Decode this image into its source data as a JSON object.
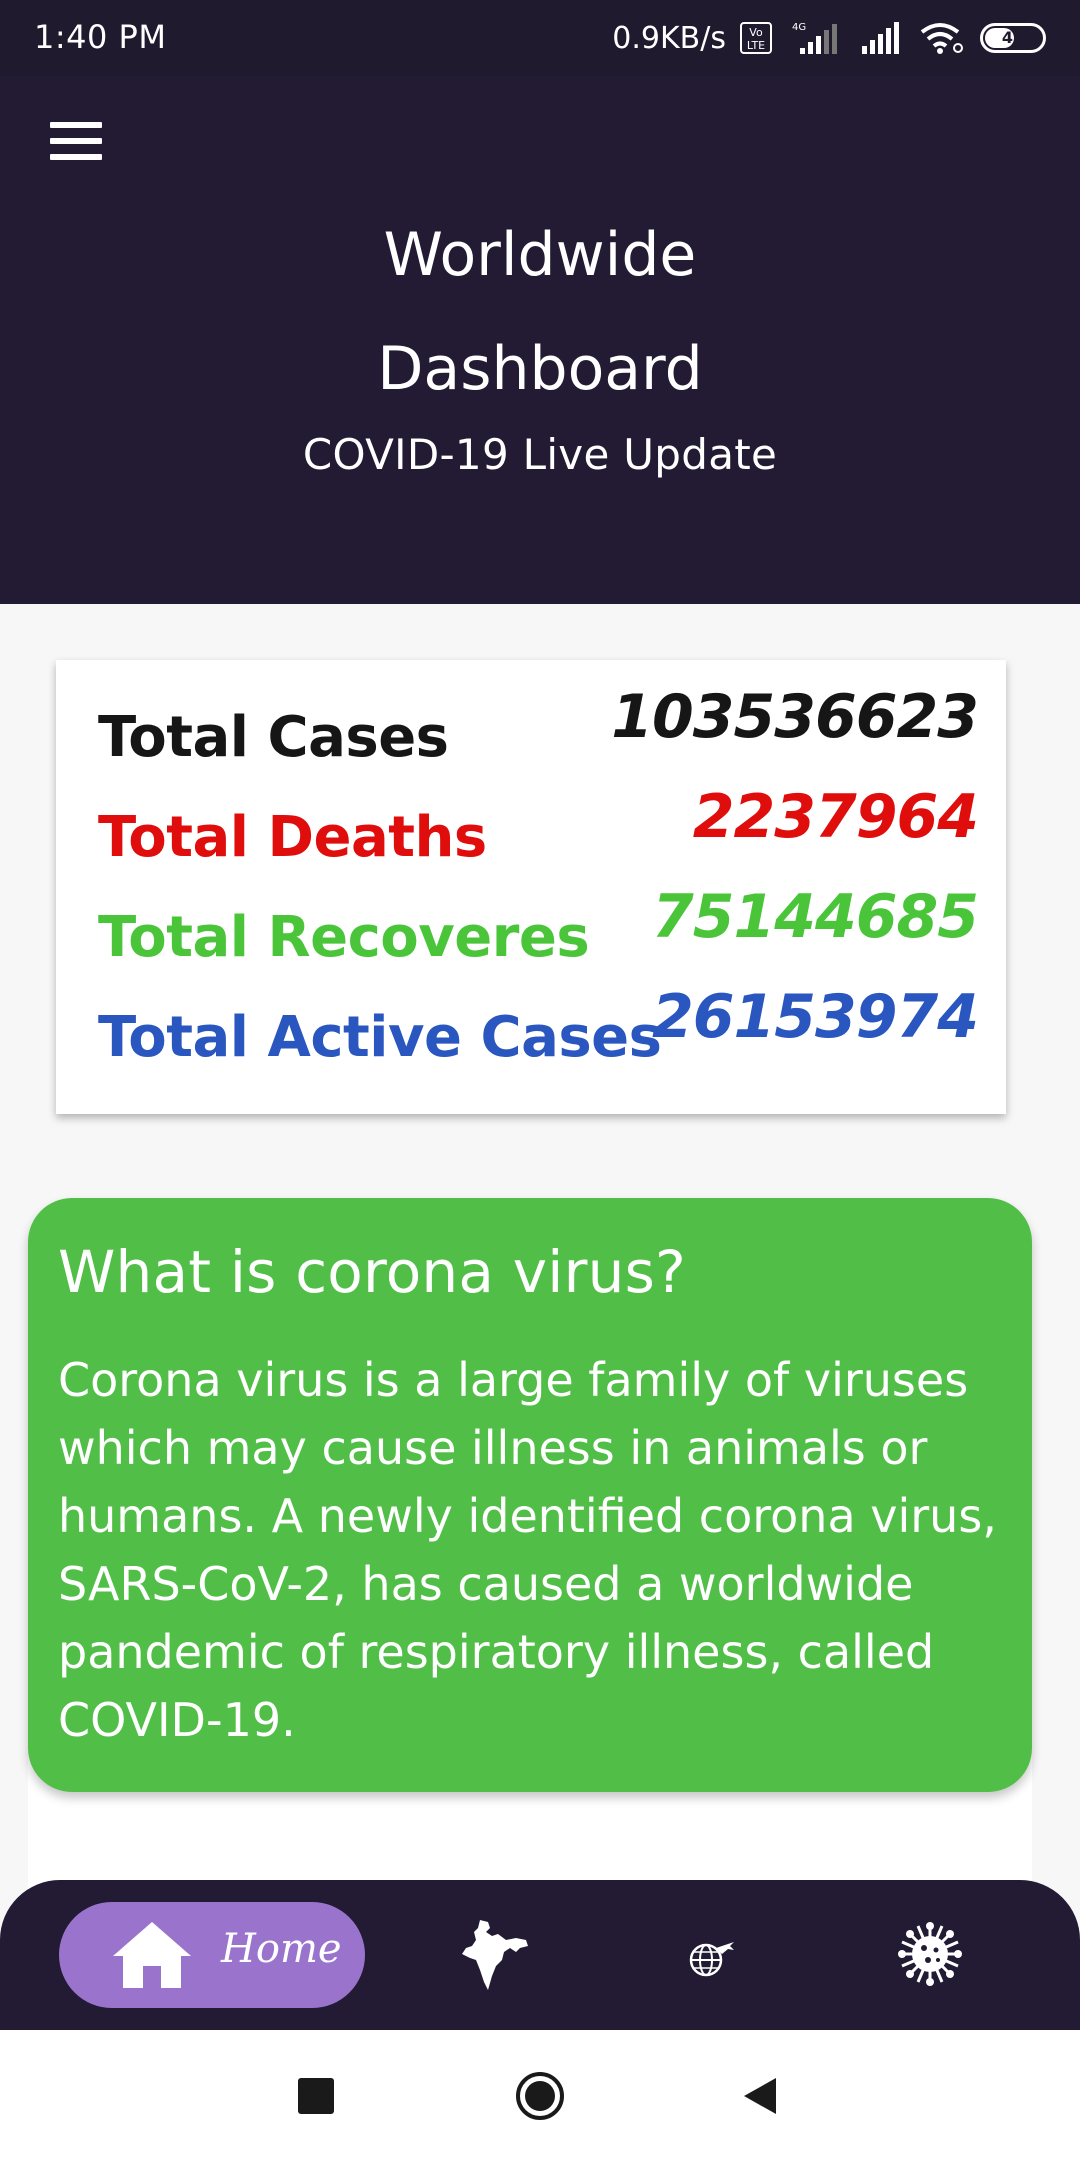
{
  "status_bar": {
    "time": "1:40 PM",
    "net_speed": "0.9KB/s",
    "volte": "Vo LTE",
    "network_type": "4G",
    "battery_level": "49"
  },
  "header": {
    "title": "Worldwide Dashboard",
    "subtitle": "COVID-19 Live Update"
  },
  "stats": [
    {
      "label": "Total Cases",
      "value": "103536623",
      "color": "#161616"
    },
    {
      "label": "Total Deaths",
      "value": "2237964",
      "color": "#e00d0d"
    },
    {
      "label": "Total Recoveres",
      "value": "75144685",
      "color": "#4ac53a"
    },
    {
      "label": "Total Active Cases",
      "value": "26153974",
      "color": "#2a56c0"
    }
  ],
  "info": {
    "title": "What is corona virus?",
    "body": "Corona virus is a large family of viruses which may cause illness in animals or humans. A newly identified corona virus, SARS-CoV-2, has caused a worldwide pandemic of respiratory illness, called COVID-19."
  },
  "bottom_nav": {
    "home_label": "Home",
    "items": [
      {
        "icon": "home-icon",
        "selected": true
      },
      {
        "icon": "india-map-icon",
        "selected": false
      },
      {
        "icon": "globe-plane-icon",
        "selected": false
      },
      {
        "icon": "virus-icon",
        "selected": false
      }
    ]
  },
  "colors": {
    "header_bg": "#221b33",
    "nav_pill": "#9a74cc",
    "info_card_bg": "#51bf47"
  }
}
